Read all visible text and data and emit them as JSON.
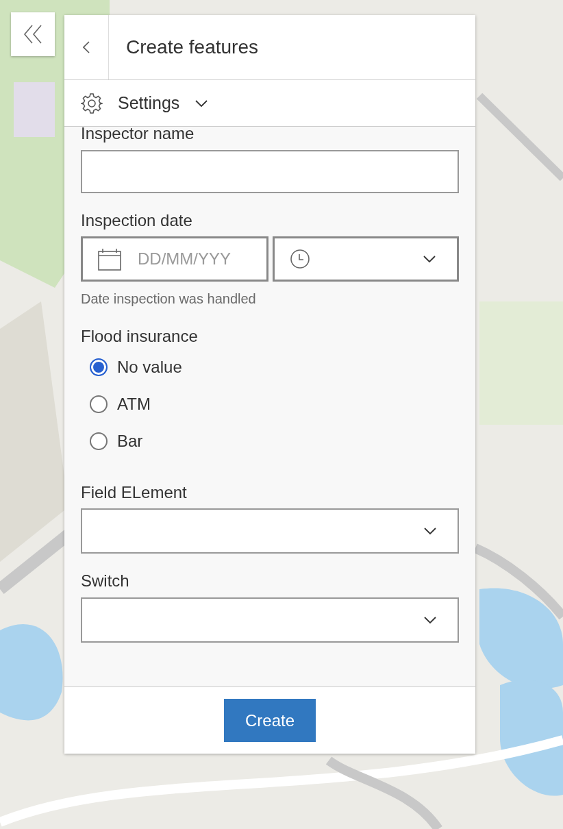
{
  "panel": {
    "title": "Create features",
    "settings": {
      "label": "Settings",
      "expanded": false
    },
    "fields": [
      {
        "kind": "text",
        "label": "Inspector name"
      },
      {
        "kind": "datetime",
        "label": "Inspection date",
        "date_placeholder": "DD/MM/YYY",
        "hint": "Date inspection was handled"
      },
      {
        "kind": "radio",
        "label": "Flood insurance",
        "options": [
          {
            "label": "No value",
            "selected": true
          },
          {
            "label": "ATM",
            "selected": false
          },
          {
            "label": "Bar",
            "selected": false
          }
        ]
      },
      {
        "kind": "select",
        "label": "Field ELement"
      },
      {
        "kind": "select",
        "label": "Switch"
      }
    ],
    "submit": "Create"
  }
}
